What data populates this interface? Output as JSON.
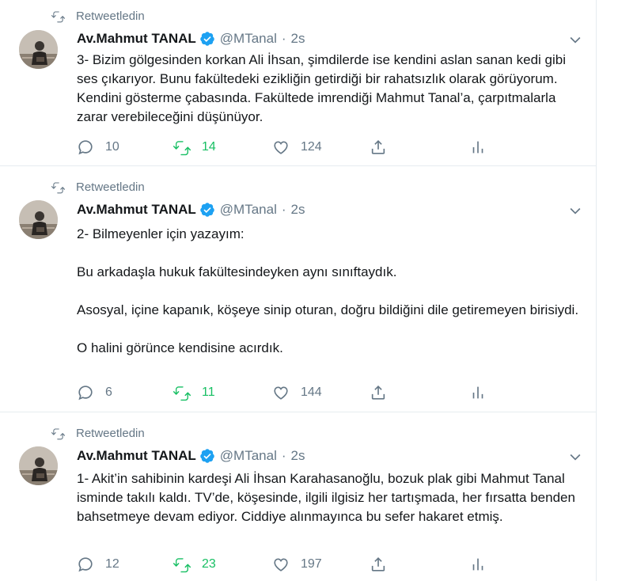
{
  "colors": {
    "accent": "#1da1f2",
    "muted": "#657786",
    "retweet_green": "#17bf63",
    "text": "#14171a"
  },
  "tweets": [
    {
      "retweet_label": "Retweetledin",
      "name": "Av.Mahmut TANAL",
      "handle": "@MTanal",
      "time": "2s",
      "paragraphs": [
        "3- Bizim gölgesinden korkan Ali İhsan, şimdilerde ise kendini aslan sanan kedi gibi ses çıkarıyor. Bunu fakültedeki ezikliğin getirdiği bir rahatsızlık olarak görüyorum. Kendini gösterme çabasında. Fakültede imrendiği Mahmut Tanal’a, çarpıtmalarla zarar verebileceğini düşünüyor."
      ],
      "replies": "10",
      "retweets": "14",
      "likes": "124"
    },
    {
      "retweet_label": "Retweetledin",
      "name": "Av.Mahmut TANAL",
      "handle": "@MTanal",
      "time": "2s",
      "paragraphs": [
        "2- Bilmeyenler için yazayım:",
        "Bu arkadaşla hukuk fakültesindeyken aynı sınıftaydık.",
        "Asosyal, içine kapanık, köşeye sinip oturan, doğru bildiğini dile getiremeyen birisiydi.",
        "O halini görünce kendisine acırdık."
      ],
      "replies": "6",
      "retweets": "11",
      "likes": "144"
    },
    {
      "retweet_label": "Retweetledin",
      "name": "Av.Mahmut TANAL",
      "handle": "@MTanal",
      "time": "2s",
      "paragraphs": [
        "1- Akit’in sahibinin kardeşi Ali İhsan Karahasanoğlu, bozuk plak gibi Mahmut Tanal isminde takılı kaldı. TV’de, köşesinde, ilgili ilgisiz her tartışmada, her fırsatta benden bahsetmeye devam ediyor. Ciddiye alınmayınca bu sefer hakaret etmiş."
      ],
      "replies": "12",
      "retweets": "23",
      "likes": "197"
    }
  ]
}
